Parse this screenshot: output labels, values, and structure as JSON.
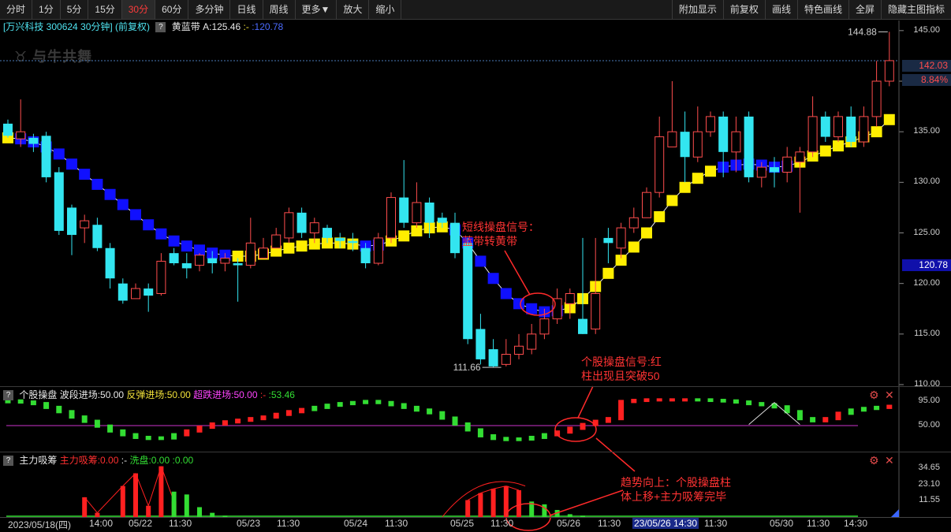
{
  "toolbar": {
    "left": [
      "分时",
      "1分",
      "5分",
      "15分",
      "30分",
      "60分",
      "多分钟",
      "日线",
      "周线",
      "更多▼",
      "放大",
      "缩小"
    ],
    "active_index": 4,
    "right": [
      "附加显示",
      "前复权",
      "画线",
      "特色画线",
      "全屏",
      "隐藏主图指标"
    ]
  },
  "header": {
    "stock_title": "[万兴科技 300624 30分钟] (前复权)",
    "indicator_name": "黄蓝带",
    "indicator_a": "A:125.46",
    "indicator_dash": ":-",
    "indicator_b": ":120.78"
  },
  "logo_text": "与牛共舞",
  "price_tags": {
    "last": "142.03",
    "pct": "8.84%",
    "band": "120.78"
  },
  "panel2_header": {
    "name": "个股操盘",
    "wave": "波段进场:50.00",
    "rebound": "反弹进场:50.00",
    "oversold": "超跌进场:50.00",
    "dash": ":-",
    "value": ":53.46"
  },
  "panel3_header": {
    "name": "主力吸筹",
    "main": "主力吸筹:0.00",
    "dash": ":-",
    "wash": "洗盘:0.00",
    "value": ":0.00"
  },
  "x_labels": [
    "2023/05/18(四)",
    "14:00",
    "05/22",
    "11:30",
    "05/23",
    "11:30",
    "05/24",
    "11:30",
    "05/25",
    "11:30",
    "05/26",
    "11:30",
    "23/05/26 14:30",
    "11:30",
    "05/30",
    "11:30",
    "14:30"
  ],
  "annotations": {
    "a1_line1": "短线操盘信号：",
    "a1_line2": "蓝带转黄带",
    "a2_line1": "个股操盘信号:红",
    "a2_line2": "柱出现且突破50",
    "a3_line1": "趋势向上：个股操盘柱",
    "a3_line2": "体上移+主力吸筹完毕"
  },
  "colors": {
    "up": "#ff4d4d",
    "down": "#33e5f0",
    "band_yellow": "#ffee00",
    "band_blue": "#1010ff",
    "green": "#33dd33",
    "red": "#ff2020",
    "magenta": "#cc33cc"
  },
  "chart_data": [
    {
      "type": "candlestick",
      "title": "",
      "ylim": [
        110,
        146
      ],
      "y_ticks": [
        "145.00",
        "140.00",
        "135.00",
        "130.00",
        "125.00",
        "120.00",
        "115.00",
        "110.00"
      ],
      "marked_high": "144.88",
      "marked_low": "111.66",
      "candles": [
        [
          135.8,
          134.6,
          136.2,
          134.4
        ],
        [
          134.3,
          135.0,
          138.2,
          133.5
        ],
        [
          134.4,
          133.8,
          134.8,
          133.0
        ],
        [
          134.6,
          130.5,
          135.0,
          130.0
        ],
        [
          131.0,
          125.2,
          131.5,
          124.8
        ],
        [
          127.5,
          124.8,
          127.8,
          122.8
        ],
        [
          125.5,
          126.2,
          126.8,
          124.0
        ],
        [
          125.8,
          123.5,
          126.5,
          123.2
        ],
        [
          123.5,
          120.5,
          124.0,
          119.5
        ],
        [
          120.0,
          118.3,
          120.5,
          118.0
        ],
        [
          118.5,
          119.5,
          120.0,
          118.5
        ],
        [
          119.5,
          118.8,
          120.0,
          117.2
        ],
        [
          119.0,
          122.2,
          123.0,
          118.8
        ],
        [
          123.0,
          122.0,
          123.5,
          121.8
        ],
        [
          122.0,
          121.5,
          123.0,
          120.5
        ],
        [
          121.8,
          122.8,
          123.0,
          121.2
        ],
        [
          122.5,
          122.0,
          123.2,
          121.0
        ],
        [
          122.0,
          122.5,
          123.0,
          121.2
        ],
        [
          122.0,
          121.8,
          122.5,
          118.2
        ],
        [
          121.8,
          124.0,
          126.5,
          121.5
        ],
        [
          122.5,
          123.5,
          124.5,
          122.5
        ],
        [
          123.5,
          124.8,
          125.5,
          123.5
        ],
        [
          124.5,
          127.0,
          127.5,
          124.0
        ],
        [
          127.0,
          125.0,
          127.5,
          124.5
        ],
        [
          125.0,
          126.0,
          126.5,
          124.0
        ],
        [
          125.5,
          124.5,
          125.8,
          124.0
        ],
        [
          124.5,
          124.2,
          125.0,
          123.5
        ],
        [
          124.2,
          124.0,
          125.0,
          123.2
        ],
        [
          123.5,
          122.0,
          124.0,
          121.5
        ],
        [
          122.0,
          124.5,
          125.0,
          121.8
        ],
        [
          124.5,
          128.5,
          129.0,
          124.0
        ],
        [
          128.5,
          126.0,
          132.2,
          125.5
        ],
        [
          126.0,
          128.0,
          130.0,
          125.5
        ],
        [
          128.0,
          126.0,
          128.5,
          124.5
        ],
        [
          126.5,
          126.0,
          127.0,
          125.5
        ],
        [
          126.0,
          123.0,
          127.0,
          122.5
        ],
        [
          124.0,
          114.5,
          124.5,
          114.0
        ],
        [
          115.5,
          112.5,
          117.0,
          112.0
        ],
        [
          113.5,
          111.8,
          114.5,
          111.7
        ],
        [
          112.0,
          113.0,
          114.5,
          111.8
        ],
        [
          113.0,
          113.8,
          115.0,
          112.5
        ],
        [
          113.5,
          115.0,
          116.0,
          113.0
        ],
        [
          115.0,
          116.5,
          117.5,
          114.5
        ],
        [
          116.5,
          118.5,
          119.5,
          116.0
        ],
        [
          118.0,
          119.0,
          119.5,
          116.5
        ],
        [
          116.5,
          115.0,
          124.5,
          115.0
        ],
        [
          115.5,
          119.0,
          124.5,
          115.0
        ],
        [
          124.5,
          124.0,
          125.5,
          122.0
        ],
        [
          123.5,
          125.5,
          126.0,
          122.5
        ],
        [
          125.5,
          126.5,
          127.5,
          125.0
        ],
        [
          126.5,
          129.0,
          129.5,
          126.5
        ],
        [
          129.0,
          134.5,
          136.5,
          128.5
        ],
        [
          133.5,
          135.0,
          140.0,
          133.5
        ],
        [
          135.0,
          132.5,
          137.0,
          130.0
        ],
        [
          132.5,
          135.0,
          137.5,
          132.0
        ],
        [
          135.0,
          136.5,
          137.0,
          134.5
        ],
        [
          136.5,
          133.0,
          137.0,
          130.5
        ],
        [
          133.0,
          135.0,
          136.5,
          131.0
        ],
        [
          136.5,
          130.5,
          137.0,
          130.0
        ],
        [
          130.5,
          131.5,
          132.0,
          129.5
        ],
        [
          131.5,
          131.0,
          132.5,
          129.5
        ],
        [
          131.0,
          132.5,
          133.5,
          130.0
        ],
        [
          132.0,
          133.0,
          133.5,
          127.0
        ],
        [
          133.0,
          136.5,
          138.5,
          132.5
        ],
        [
          136.5,
          134.5,
          137.0,
          134.0
        ],
        [
          134.5,
          136.5,
          137.0,
          134.0
        ],
        [
          136.5,
          134.0,
          137.5,
          133.5
        ],
        [
          134.0,
          136.5,
          137.5,
          133.5
        ],
        [
          136.5,
          140.0,
          142.0,
          135.5
        ],
        [
          140.0,
          142.03,
          144.88,
          139.5
        ]
      ],
      "band": [
        134.4,
        134.3,
        134.0,
        133.5,
        132.8,
        131.8,
        130.8,
        129.8,
        128.8,
        127.8,
        126.8,
        125.8,
        124.9,
        124.2,
        123.7,
        123.3,
        123.0,
        122.8,
        122.7,
        122.7,
        122.9,
        123.2,
        123.5,
        123.7,
        123.9,
        124.0,
        124.0,
        123.9,
        123.7,
        123.8,
        124.2,
        124.7,
        125.2,
        125.5,
        125.6,
        125.3,
        124.0,
        122.2,
        120.5,
        119.0,
        118.0,
        117.5,
        117.2,
        117.3,
        117.6,
        118.5,
        119.7,
        121.0,
        122.3,
        123.6,
        125.0,
        126.6,
        128.2,
        129.5,
        130.4,
        131.1,
        131.5,
        131.7,
        131.8,
        131.7,
        131.5,
        131.6,
        132.0,
        132.6,
        133.1,
        133.6,
        134.0,
        134.5,
        135.0,
        136.2
      ],
      "band_colors": "YBBBBBBBBBBBBBBBBBYYYYYYYYYYBBYYYYYBBBBBBBBBYYYYYYYYYYYYBBBBBBYYYYYYYY"
    },
    {
      "type": "bar",
      "title": "个股操盘",
      "ylim": [
        0,
        100
      ],
      "y_ticks": [
        "95.00",
        "50.00"
      ],
      "reference": 50,
      "values": [
        96,
        94,
        91,
        84,
        76,
        66,
        58,
        49,
        40,
        33,
        28,
        26,
        27,
        33,
        40,
        47,
        53,
        57,
        60,
        63,
        66,
        71,
        76,
        80,
        84,
        88,
        91,
        93,
        95,
        93,
        89,
        84,
        79,
        74,
        64,
        53,
        42,
        31,
        26,
        24,
        25,
        28,
        33,
        38,
        45,
        52,
        58,
        63,
        95,
        97,
        98,
        98,
        98,
        98,
        98,
        97,
        96,
        94,
        91,
        89,
        85,
        76,
        63,
        59,
        63,
        73,
        79,
        82,
        84,
        86
      ],
      "colors": "GGGGGGGGGGGGGGRRRRRRRRRRGGGGGGGGGGGGGGGGGGGRRRRRRRRRRRGGGGGGGGGGRRGGGRR"
    },
    {
      "type": "bar",
      "title": "主力吸筹",
      "ylim": [
        0,
        34.65
      ],
      "y_ticks": [
        "34.65",
        "23.10",
        "11.55"
      ],
      "main": [
        0,
        0,
        0,
        0,
        0,
        0,
        14,
        3,
        0,
        22,
        31,
        8,
        36,
        11,
        0,
        0,
        0,
        0,
        0,
        0,
        0,
        0,
        0,
        0,
        0,
        0,
        0,
        0,
        0,
        0,
        0,
        0,
        0,
        0,
        0,
        0,
        12,
        17,
        20,
        22,
        19,
        0,
        0,
        0,
        0,
        0,
        0,
        0,
        0,
        0,
        0,
        0,
        0,
        0,
        0,
        0,
        0,
        0,
        0,
        0,
        0,
        0,
        0,
        0,
        0,
        0,
        0,
        0,
        0,
        0
      ],
      "wash": [
        0,
        0,
        0,
        0,
        0,
        0,
        0,
        0,
        0,
        0,
        0,
        0,
        0,
        18,
        16,
        7,
        3,
        1,
        0,
        0,
        0,
        0,
        0,
        0,
        0,
        0,
        0,
        0,
        0,
        0,
        0,
        0,
        0,
        0,
        0,
        0,
        0,
        0,
        0,
        0,
        0,
        11,
        9,
        5,
        2,
        1,
        0,
        0,
        0,
        0,
        0,
        0,
        0,
        0,
        0,
        0,
        0,
        0,
        0,
        0,
        0,
        0,
        0,
        0,
        0,
        0,
        0,
        0,
        0,
        0
      ]
    }
  ]
}
